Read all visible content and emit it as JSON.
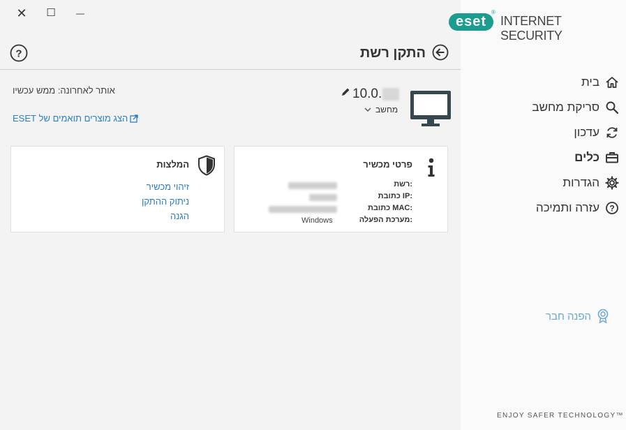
{
  "window": {
    "close_glyph": "✕",
    "maximize_glyph": "☐",
    "minimize_glyph": "—"
  },
  "brand": {
    "logo": "eset",
    "product": "INTERNET SECURITY",
    "accent_color": "#1a9d8f"
  },
  "sidebar": {
    "items": [
      {
        "label": "בית",
        "icon": "home-icon"
      },
      {
        "label": "סריקת מחשב",
        "icon": "search-icon"
      },
      {
        "label": "עדכון",
        "icon": "refresh-icon"
      },
      {
        "label": "כלים",
        "icon": "toolbox-icon",
        "active": true
      },
      {
        "label": "הגדרות",
        "icon": "gear-icon"
      },
      {
        "label": "עזרה ותמיכה",
        "icon": "help-icon"
      }
    ],
    "refer_friend": "הפנה חבר",
    "tagline": "ENJOY SAFER TECHNOLOGY™"
  },
  "header": {
    "title": "התקן רשת"
  },
  "device": {
    "ip_prefix": "10.0.",
    "type": "מחשב",
    "last_seen": "אותר לאחרונה: ממש עכשיו",
    "eset_link": "הצג מוצרים תואמים של ESET"
  },
  "details_card": {
    "title": "פרטי מכשיר",
    "rows": [
      {
        "label": "רשת:",
        "value": ""
      },
      {
        "label": "כתובת IP:",
        "value": ""
      },
      {
        "label": "כתובת MAC:",
        "value": ""
      },
      {
        "label": "מערכת הפעלה:",
        "value": "Windows"
      }
    ]
  },
  "recommendations_card": {
    "title": "המלצות",
    "links": [
      "זיהוי מכשיר",
      "ניתוק ההתקן",
      "הגנה"
    ]
  }
}
